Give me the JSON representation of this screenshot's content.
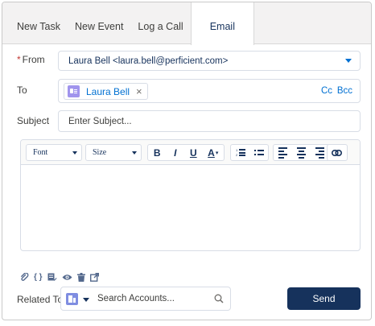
{
  "tabs": [
    {
      "label": "New Task"
    },
    {
      "label": "New Event"
    },
    {
      "label": "Log a Call"
    },
    {
      "label": "Email"
    }
  ],
  "active_tab": "Email",
  "from": {
    "required_marker": "*",
    "label": "From",
    "value": "Laura Bell <laura.bell@perficient.com>"
  },
  "to": {
    "label": "To",
    "recipients": [
      {
        "name": "Laura Bell",
        "icon": "contact-icon"
      }
    ],
    "remove_glyph": "×",
    "cc_label": "Cc",
    "bcc_label": "Bcc"
  },
  "subject": {
    "label": "Subject",
    "placeholder": "Enter Subject..."
  },
  "toolbar": {
    "font_label": "Font",
    "size_label": "Size",
    "bold": "B",
    "italic": "I",
    "underline": "U",
    "text_color": "A"
  },
  "related_to": {
    "label": "Related To",
    "placeholder": "Search Accounts...",
    "object_icon": "account-icon"
  },
  "send_label": "Send",
  "colors": {
    "brand_dark": "#16325c",
    "link": "#0070d2",
    "contact_icon": "#a094ed",
    "account_icon": "#7f8de1",
    "required": "#c23934"
  }
}
